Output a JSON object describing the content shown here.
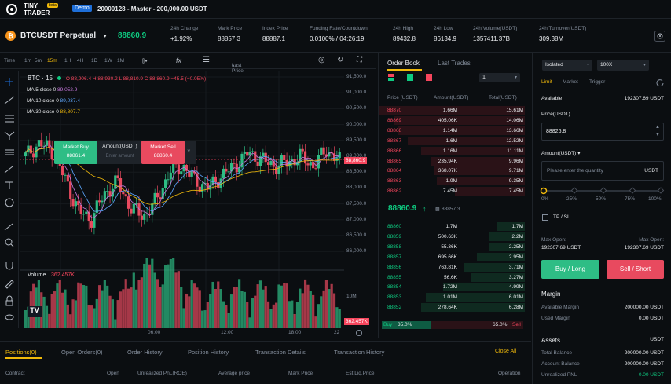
{
  "header": {
    "logo_text_1": "TINY",
    "logo_text_2": "TRADER",
    "logo_badge": "beta",
    "demo_badge": "Demo",
    "account": "20000128 - Master - 200,000.00 USDT"
  },
  "ticker": {
    "symbol": "BTCUSDT Perpetual",
    "price": "88860.9",
    "stats": [
      {
        "label": "24h Change",
        "value": "+1.92%",
        "color": "green"
      },
      {
        "label": "Mark Price",
        "value": "88857.3",
        "color": ""
      },
      {
        "label": "Index Price",
        "value": "88887.1",
        "color": ""
      },
      {
        "label": "Funding Rate/Countdown",
        "value": "0.0100% / 04:26:19",
        "color": ""
      },
      {
        "label": "24h High",
        "value": "89432.8",
        "color": ""
      },
      {
        "label": "24h Low",
        "value": "86134.9",
        "color": ""
      },
      {
        "label": "24h Volume(USDT)",
        "value": "1357411.37B",
        "color": ""
      },
      {
        "label": "24h Turnover(USDT)",
        "value": "309.38M",
        "color": ""
      }
    ]
  },
  "chart_toolbar": {
    "intervals": [
      "Time",
      "1m",
      "5m",
      "15m",
      "1H",
      "4H",
      "1D",
      "1W",
      "1M"
    ],
    "active_interval": "15m",
    "fx": "fx",
    "last_price": "Last Price"
  },
  "chart_legend": {
    "symbol": "BTC · 15",
    "ohlc": "O 88,906.4  H 88,930.2  L 88,810.9  C 88,860.9  −45.5 (−0.05%)",
    "ma5": "MA 5 close 0",
    "ma5_val": "89,052.9",
    "ma10": "MA 10 close 0",
    "ma10_val": "89,037.4",
    "ma30": "MA 30 close 0",
    "ma30_val": "88,807.7"
  },
  "quick_order": {
    "buy_label": "Market Buy",
    "buy_price": "88861.4",
    "amount_label": "Amount(USDT)",
    "amount_placeholder": "Enter amount",
    "sell_label": "Market Sell",
    "sell_price": "88860.4"
  },
  "price_axis": {
    "ticks": [
      "91,500.0",
      "91,000.0",
      "90,500.0",
      "90,000.0",
      "89,500.0",
      "89,000.0",
      "88,500.0",
      "88,000.0",
      "87,500.0",
      "87,000.0",
      "86,500.0",
      "86,000.0"
    ],
    "current": "88,860.9",
    "vol_tick": "10M",
    "vol_current": "362.457K"
  },
  "time_axis": [
    "06:00",
    "12:00",
    "18:00",
    "22"
  ],
  "volume_label": "Volume",
  "volume_value": "362.457K",
  "order_book": {
    "tab_active": "Order Book",
    "tab_other": "Last Trades",
    "precision": "1",
    "col_price": "Price (USDT)",
    "col_amount": "Amount(USDT)",
    "col_total": "Total(USDT)",
    "asks": [
      [
        "88870",
        "1.66M",
        "15.61M",
        1.0
      ],
      [
        "88869",
        "405.06K",
        "14.06M",
        0.9
      ],
      [
        "88868",
        "1.14M",
        "13.66M",
        0.87
      ],
      [
        "88867",
        "1.6M",
        "12.52M",
        0.8
      ],
      [
        "88866",
        "1.16M",
        "11.11M",
        0.71
      ],
      [
        "88865",
        "235.94K",
        "9.96M",
        0.64
      ],
      [
        "88864",
        "368.07K",
        "9.71M",
        0.62
      ],
      [
        "88863",
        "1.9M",
        "9.35M",
        0.6
      ],
      [
        "88862",
        "7.45M",
        "7.45M",
        0.48
      ]
    ],
    "last_price": "88860.9",
    "mark": "88857.3",
    "bids": [
      [
        "88860",
        "1.7M",
        "1.7M",
        0.19
      ],
      [
        "88859",
        "500.63K",
        "2.2M",
        0.25
      ],
      [
        "88858",
        "55.36K",
        "2.25M",
        0.25
      ],
      [
        "88857",
        "695.66K",
        "2.95M",
        0.33
      ],
      [
        "88856",
        "763.81K",
        "3.71M",
        0.42
      ],
      [
        "88855",
        "56.6K",
        "3.27M",
        0.37
      ],
      [
        "88854",
        "1.72M",
        "4.99M",
        0.56
      ],
      [
        "88853",
        "1.01M",
        "6.01M",
        0.68
      ],
      [
        "88852",
        "278.64K",
        "6.28M",
        0.71
      ]
    ],
    "buy_pct_label": "Buy",
    "buy_pct": "35.0%",
    "sell_pct": "65.0%",
    "sell_pct_label": "Sell",
    "buy_ratio": 0.35
  },
  "trade_panel": {
    "margin_mode": "Isolated",
    "leverage": "100X",
    "order_types": [
      "Limit",
      "Market",
      "Trigger"
    ],
    "available_label": "Available",
    "available_value": "192307.69 USDT",
    "price_label": "Price(USDT)",
    "price_value": "88826.8",
    "amount_label": "Amount(USDT)",
    "amount_placeholder": "Please enter the quantity",
    "amount_unit": "USDT",
    "slider_marks": [
      "0%",
      "25%",
      "50%",
      "75%",
      "100%"
    ],
    "tpsl_label": "TP / SL",
    "max_open_label": "Max Open:",
    "max_open_long": "192307.69 USDT",
    "max_open_short": "192307.69 USDT",
    "buy_button": "Buy / Long",
    "sell_button": "Sell / Short",
    "margin_title": "Margin",
    "available_margin_label": "Available Margin",
    "available_margin_value": "200000.00 USDT",
    "used_margin_label": "Used Margin",
    "used_margin_value": "0.00 USDT",
    "assets_title": "Assets",
    "assets_unit": "USDT",
    "total_balance_label": "Total Balance",
    "total_balance_value": "200000.00 USDT",
    "account_balance_label": "Account Balance",
    "account_balance_value": "200000.00 USDT",
    "unrealized_label": "Unrealized PNL",
    "unrealized_value": "0.00 USDT"
  },
  "bottom": {
    "tabs": [
      "Positions(0)",
      "Open Orders(0)",
      "Order History",
      "Position History",
      "Transaction Details",
      "Transaction History"
    ],
    "close_all": "Close All",
    "columns": [
      "Contract",
      "Open",
      "Unrealized PnL(ROE)",
      "Average price",
      "Mark Price",
      "Est.Liq.Price",
      "Operation"
    ]
  },
  "colors": {
    "green": "#0ecb81",
    "red": "#f6465d",
    "accent": "#f0b90b"
  }
}
